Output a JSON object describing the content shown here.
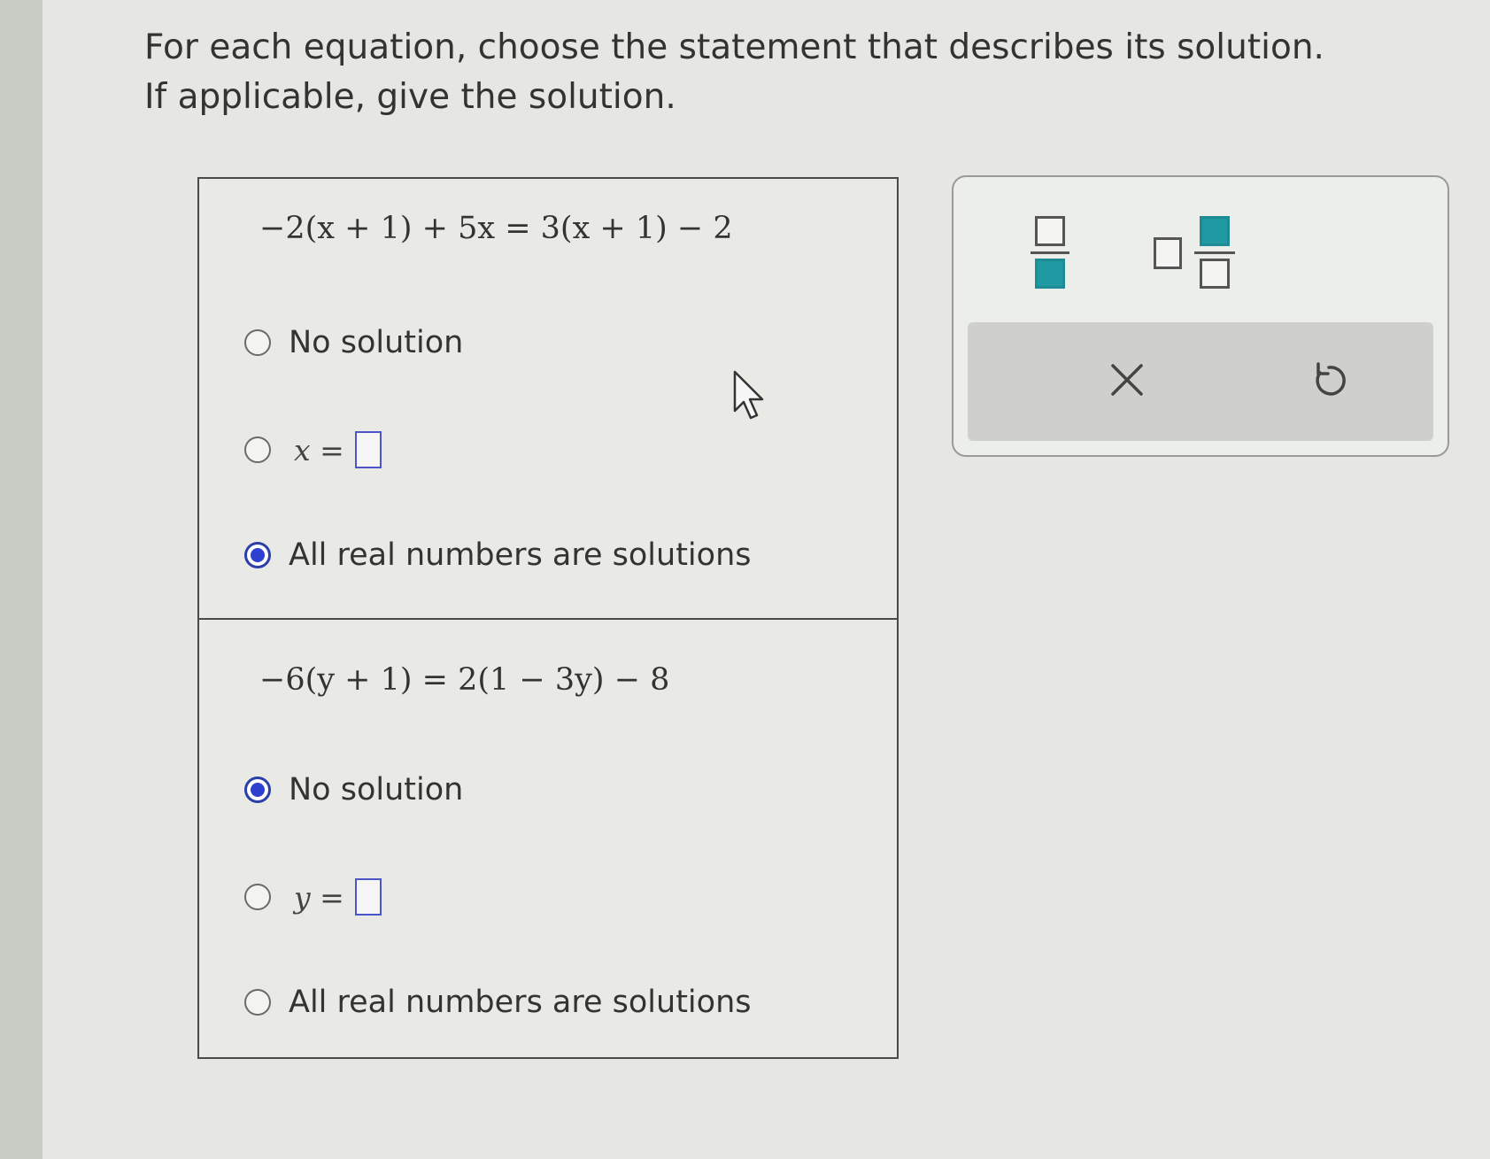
{
  "prompt": {
    "line1": "For each equation, choose the statement that describes its solution.",
    "line2": "If applicable, give the solution."
  },
  "problems": [
    {
      "equation": "−2(x + 1) + 5x = 3(x + 1) − 2",
      "options": {
        "no_solution": "No solution",
        "variable_expr": "x =",
        "all_real": "All real numbers are solutions"
      },
      "selected": "all_real"
    },
    {
      "equation": "−6(y + 1) = 2(1 − 3y) − 8",
      "options": {
        "no_solution": "No solution",
        "variable_expr": "y =",
        "all_real": "All real numbers are solutions"
      },
      "selected": "no_solution"
    }
  ],
  "toolbox": {
    "tools": [
      "fraction-icon",
      "mixed-number-icon"
    ],
    "actions": [
      "clear-icon",
      "undo-icon"
    ]
  },
  "colors": {
    "radio_selected": "#2f3fd0",
    "answer_box_border": "#4a55c8",
    "tool_teal": "#1f9aa2"
  }
}
